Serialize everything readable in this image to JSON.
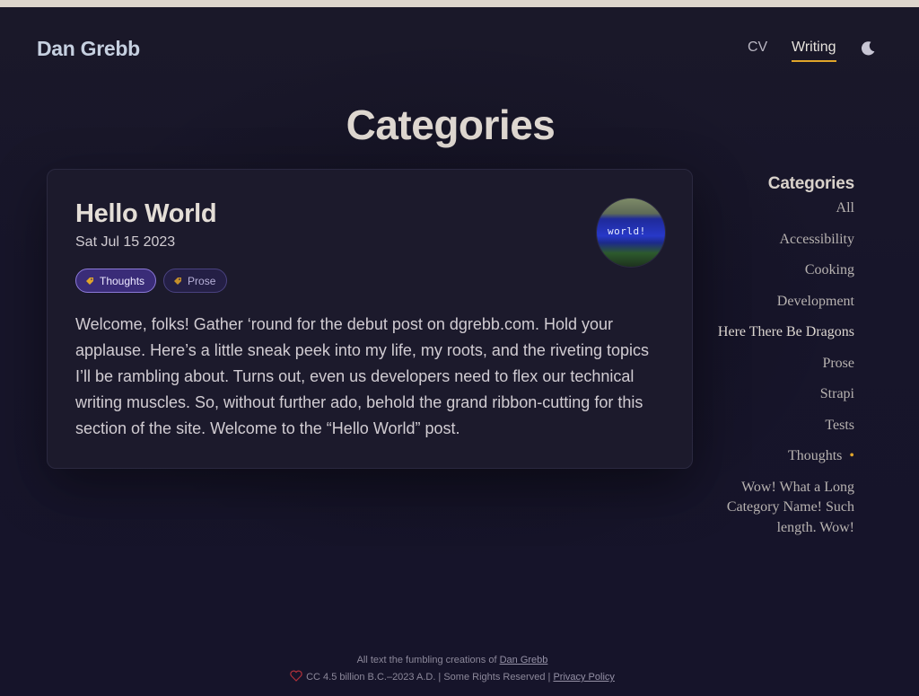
{
  "site": {
    "logo": "Dan Grebb",
    "nav": [
      {
        "label": "CV",
        "active": false
      },
      {
        "label": "Writing",
        "active": true
      }
    ],
    "theme_toggle_icon": "moon-icon"
  },
  "page": {
    "title": "Categories"
  },
  "post": {
    "title": "Hello World",
    "date": "Sat Jul 15 2023",
    "tags": [
      {
        "label": "Thoughts",
        "active": true,
        "icon": "tag-icon"
      },
      {
        "label": "Prose",
        "active": false,
        "icon": "tag-icon"
      }
    ],
    "thumbnail_text": "world!",
    "excerpt": "Welcome, folks! Gather ‘round for the debut post on dgrebb.com. Hold your applause. Here’s a little sneak peek into my life, my roots, and the riveting topics I’ll be rambling about. Turns out, even us developers need to flex our technical writing muscles. So, without further ado, behold the grand ribbon-cutting for this section of the site. Welcome to the “Hello World” post."
  },
  "sidebar": {
    "title": "Categories",
    "items": [
      {
        "label": "All"
      },
      {
        "label": "Accessibility"
      },
      {
        "label": "Cooking"
      },
      {
        "label": "Development"
      },
      {
        "label": "Here There Be Dragons"
      },
      {
        "label": "Prose"
      },
      {
        "label": "Strapi"
      },
      {
        "label": "Tests"
      },
      {
        "label": "Thoughts",
        "active": true,
        "marker": "•"
      },
      {
        "label": "Wow! What a Long Category Name! Such length. Wow!"
      }
    ]
  },
  "footer": {
    "line1_prefix": "All text the fumbling creations of",
    "line1_link": "Dan Grebb",
    "line2_text": "CC 4.5 billion B.C.–2023 A.D. | Some Rights Reserved |",
    "line2_link": "Privacy Policy"
  },
  "colors": {
    "accent": "#e0a52a",
    "background": "#18162a",
    "tag_active": "#3a2c78"
  }
}
